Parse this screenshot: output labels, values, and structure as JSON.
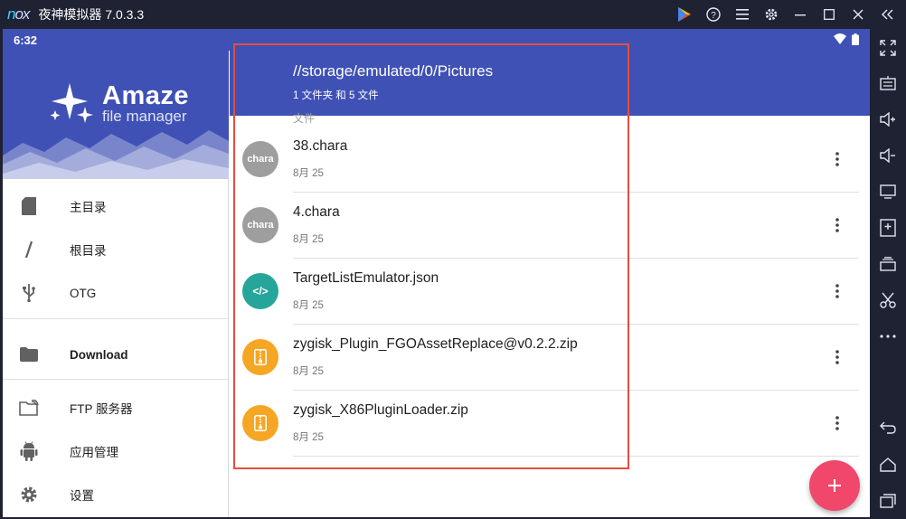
{
  "emulator": {
    "logo": "nox",
    "title": "夜神模拟器 7.0.3.3",
    "titlebar_icons": [
      "play-store-icon",
      "help-icon",
      "menu-icon",
      "settings-icon",
      "minimize-icon",
      "maximize-icon",
      "close-icon",
      "collapse-sidebar-icon"
    ],
    "sidebar_buttons": [
      "fullscreen-icon",
      "keyboard-icon",
      "volume-up-icon",
      "volume-down-icon",
      "screen-icon",
      "install-apk-icon",
      "multi-instance-icon",
      "screenshot-icon",
      "more-icon",
      "back-icon",
      "home-icon",
      "recents-icon"
    ]
  },
  "status_bar": {
    "time": "6:32"
  },
  "drawer": {
    "brand_name": "Amaze",
    "brand_sub": "file manager",
    "items": [
      {
        "label": "主目录",
        "icon": "sd-card-icon"
      },
      {
        "label": "根目录",
        "icon": "root-slash-icon"
      },
      {
        "label": "OTG",
        "icon": "usb-icon"
      },
      {
        "label": "Download",
        "icon": "folder-icon"
      },
      {
        "label": "FTP 服务器",
        "icon": "ftp-icon"
      },
      {
        "label": "应用管理",
        "icon": "android-icon"
      },
      {
        "label": "设置",
        "icon": "settings-gear-icon"
      }
    ]
  },
  "header": {
    "path": "//storage/emulated/0/Pictures",
    "summary": "1 文件夹 和 5 文件"
  },
  "section_label": "文件",
  "files": [
    {
      "name": "38.chara",
      "date": "8月 25",
      "badge": "chara",
      "icon": "chara-file-icon",
      "color": "#9e9e9e"
    },
    {
      "name": "4.chara",
      "date": "8月 25",
      "badge": "chara",
      "icon": "chara-file-icon",
      "color": "#9e9e9e"
    },
    {
      "name": "TargetListEmulator.json",
      "date": "8月 25",
      "badge": "</>",
      "icon": "code-file-icon",
      "color": "#26a69a"
    },
    {
      "name": "zygisk_Plugin_FGOAssetReplace@v0.2.2.zip",
      "date": "8月 25",
      "badge": "zip",
      "icon": "zip-file-icon",
      "color": "#f5a623"
    },
    {
      "name": "zygisk_X86PluginLoader.zip",
      "date": "8月 25",
      "badge": "zip",
      "icon": "zip-file-icon",
      "color": "#f5a623"
    }
  ],
  "colors": {
    "primary": "#3f51b5",
    "accent": "#f0476a",
    "highlight": "#e84c3d"
  }
}
